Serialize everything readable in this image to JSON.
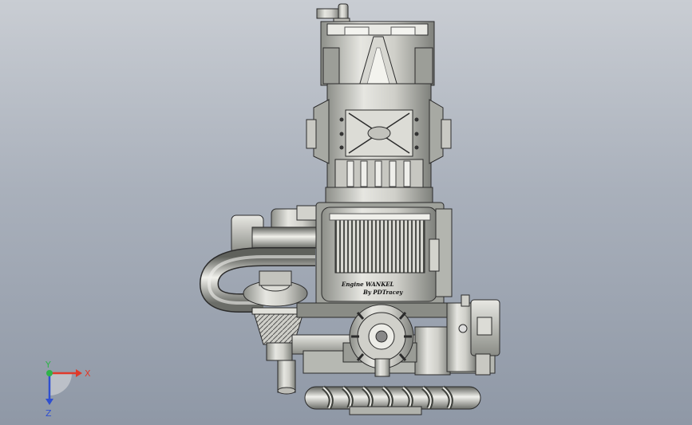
{
  "viewport": {
    "background_top": "#c9cdd3",
    "background_bottom": "#8f98a6"
  },
  "model": {
    "engraving_line1": "Engine WANKEL",
    "engraving_line2": "By PDTracey",
    "metal_light": "#e9e9e4",
    "metal_mid": "#b9bab3",
    "metal_dark": "#6e706b",
    "edge_color": "#2b2b2b"
  },
  "triad": {
    "x_label": "X",
    "y_label": "Y",
    "z_label": "Z",
    "x_color": "#e03a2a",
    "y_color": "#2fb34a",
    "z_color": "#2f4fd0"
  }
}
